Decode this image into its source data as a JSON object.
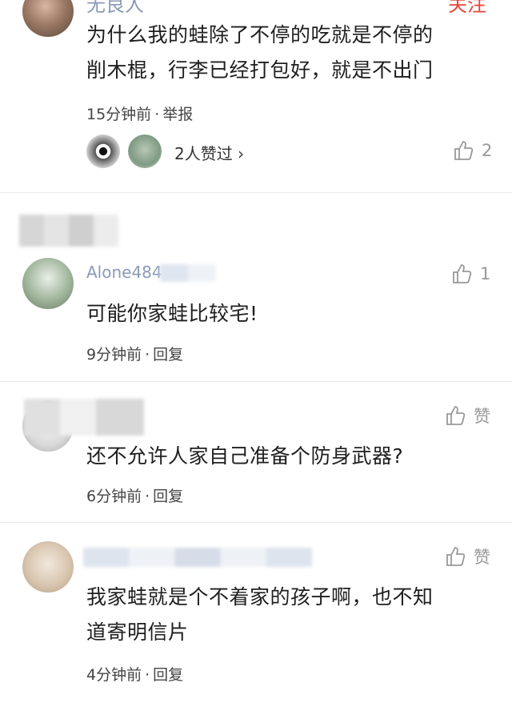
{
  "comments": [
    {
      "username": "无良人",
      "follow_label": "关注",
      "text_lines": [
        "为什么我的蛙除了不停的吃就是不停的",
        "削木棍，行李已经打包好，就是不出门"
      ],
      "time": "15分钟前",
      "action": "举报",
      "likers_text": "2人赞过 ›",
      "like_count": "2"
    },
    {
      "username": "Alone484",
      "text_lines": [
        "可能你家蛙比较宅!"
      ],
      "time": "9分钟前",
      "action": "回复",
      "like_count": "1"
    },
    {
      "text_lines": [
        "还不允许人家自己准备个防身武器?"
      ],
      "time": "6分钟前",
      "action": "回复",
      "like_label": "赞"
    },
    {
      "text_lines": [
        "我家蛙就是个不着家的孩子啊，也不知",
        "道寄明信片"
      ],
      "time": "4分钟前",
      "action": "回复",
      "like_label": "赞"
    }
  ],
  "icons": [
    "thumbs-up-icon",
    "chevron-right-icon"
  ],
  "colors": {
    "username": "#8a9bb8",
    "follow": "#e8453c",
    "meta": "#444444",
    "like": "#999999"
  }
}
